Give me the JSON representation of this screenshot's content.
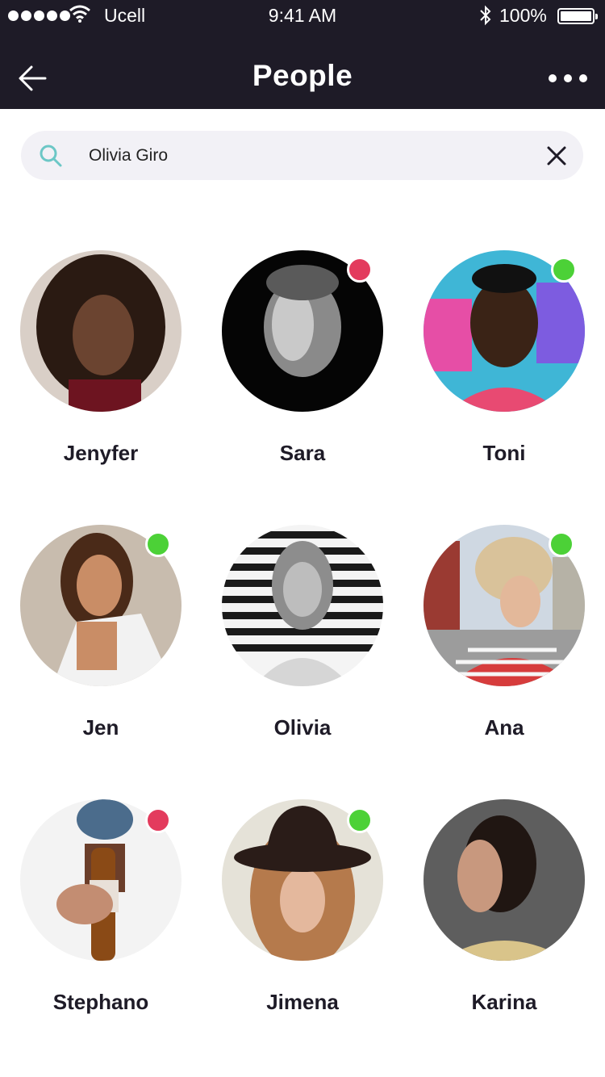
{
  "status_bar": {
    "carrier": "Ucell",
    "time": "9:41 AM",
    "battery": "100%"
  },
  "header": {
    "title": "People",
    "back_icon": "arrow-left-icon",
    "more_icon": "more-horizontal-icon"
  },
  "search": {
    "value": "Olivia Giro",
    "search_icon": "search-icon",
    "clear_icon": "close-icon",
    "accent": "#6cc7c6"
  },
  "status_colors": {
    "online": "#4cd137",
    "busy": "#e33b5d"
  },
  "people": [
    {
      "name": "Jenyfer",
      "status": "none"
    },
    {
      "name": "Sara",
      "status": "busy"
    },
    {
      "name": "Toni",
      "status": "online"
    },
    {
      "name": "Jen",
      "status": "online"
    },
    {
      "name": "Olivia",
      "status": "none"
    },
    {
      "name": "Ana",
      "status": "online"
    },
    {
      "name": "Stephano",
      "status": "busy"
    },
    {
      "name": "Jimena",
      "status": "online"
    },
    {
      "name": "Karina",
      "status": "none"
    }
  ]
}
